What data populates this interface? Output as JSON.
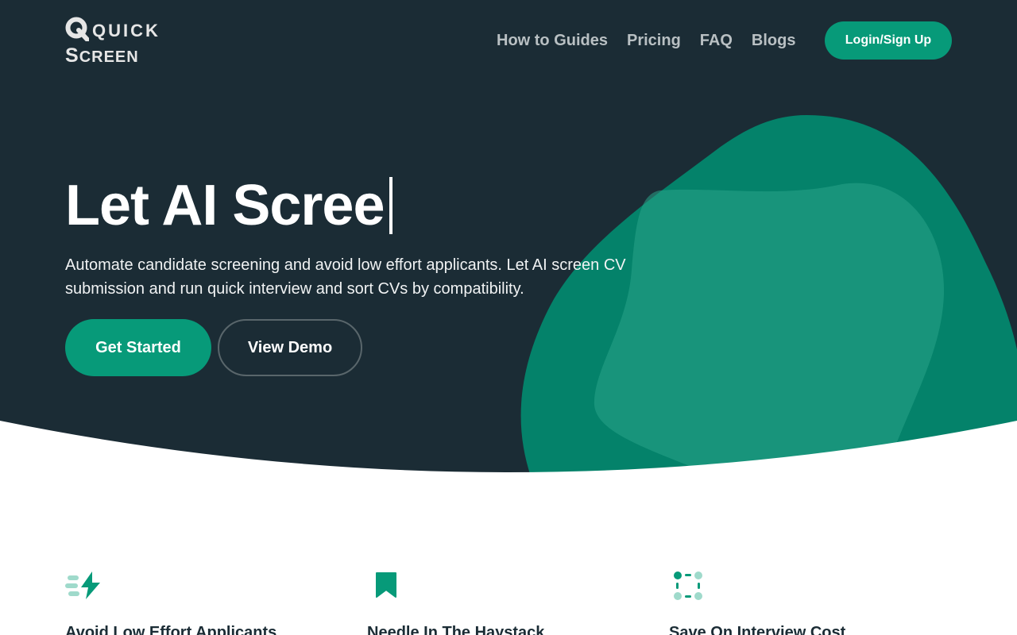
{
  "header": {
    "logo": {
      "line1": "Quick",
      "line2_big": "S",
      "line2_small": "CREEN"
    },
    "nav": [
      {
        "label": "How to Guides"
      },
      {
        "label": "Pricing"
      },
      {
        "label": "FAQ"
      },
      {
        "label": "Blogs"
      }
    ],
    "login_label": "Login/Sign Up"
  },
  "hero": {
    "headline_prefix": "Let AI ",
    "headline_highlight": "Scree",
    "subtitle": "Automate candidate screening and avoid low effort applicants. Let AI screen CV submission and run quick interview and sort CVs by compatibility.",
    "primary_cta": "Get Started",
    "secondary_cta": "View Demo"
  },
  "features": [
    {
      "title": "Avoid Low Effort Applicants",
      "icon": "lightning-icon"
    },
    {
      "title": "Needle In The Haystack",
      "icon": "bookmark-icon"
    },
    {
      "title": "Save On Interview Cost",
      "icon": "dots-square-icon"
    }
  ],
  "colors": {
    "hero_background": "#1b2c35",
    "accent": "#079a79",
    "blob_light": "#1f8e78",
    "highlight": "#7a6e28",
    "feature_title": "#1b2c35"
  }
}
